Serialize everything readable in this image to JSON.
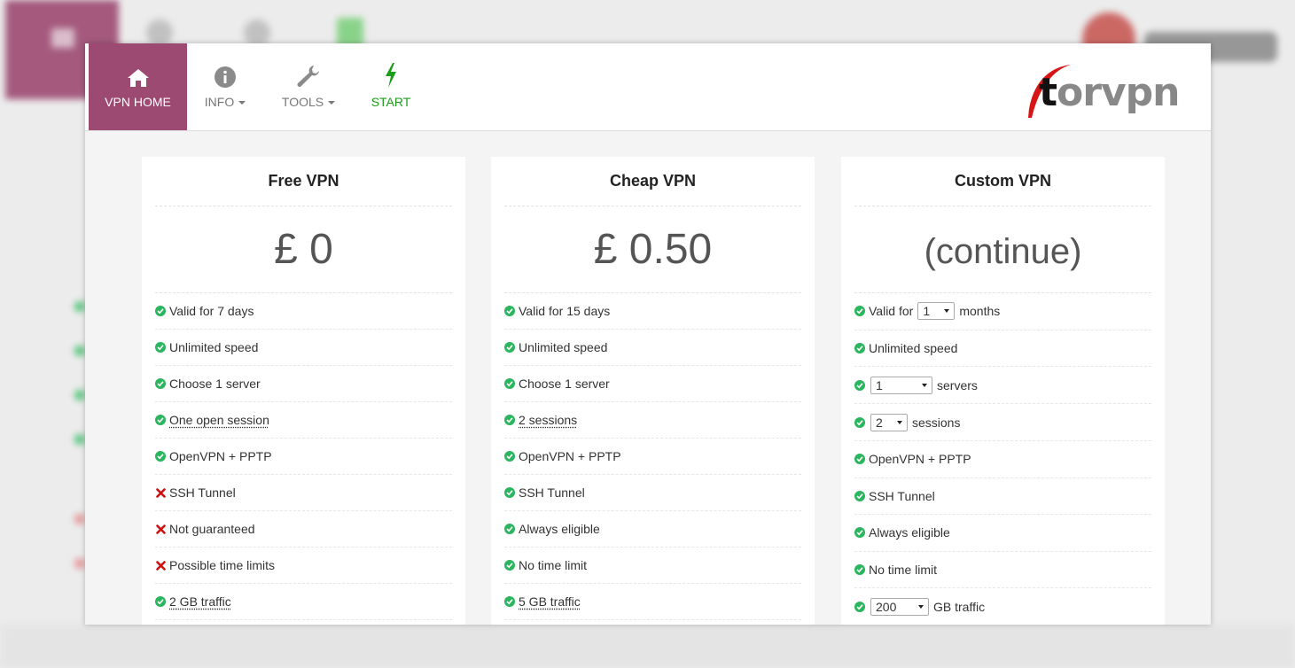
{
  "nav": {
    "items": [
      {
        "label": "VPN HOME",
        "icon": "home-icon"
      },
      {
        "label": "INFO",
        "icon": "info-icon"
      },
      {
        "label": "TOOLS",
        "icon": "wrench-icon"
      },
      {
        "label": "START",
        "icon": "lightning-icon"
      }
    ],
    "logo": {
      "first": "t",
      "rest": "orvpn"
    }
  },
  "colors": {
    "accent": "#9d4a72",
    "start": "#1a9e1a",
    "check": "#2ab55e",
    "cross": "#cc1111"
  },
  "plans": {
    "free": {
      "title": "Free VPN",
      "price": "£ 0",
      "features": [
        {
          "text": "Valid for 7 days",
          "ok": true
        },
        {
          "text": "Unlimited speed",
          "ok": true
        },
        {
          "text": "Choose 1 server",
          "ok": true
        },
        {
          "text": "One open session",
          "ok": true,
          "tip": true
        },
        {
          "text": "OpenVPN + PPTP",
          "ok": true
        },
        {
          "text": "SSH Tunnel",
          "ok": false
        },
        {
          "text": "Not guaranteed",
          "ok": false
        },
        {
          "text": "Possible time limits",
          "ok": false
        },
        {
          "text": "2 GB traffic",
          "ok": true,
          "tip": true
        }
      ]
    },
    "cheap": {
      "title": "Cheap VPN",
      "price": "£ 0.50",
      "features": [
        {
          "text": "Valid for 15 days",
          "ok": true
        },
        {
          "text": "Unlimited speed",
          "ok": true
        },
        {
          "text": "Choose 1 server",
          "ok": true
        },
        {
          "text": "2 sessions",
          "ok": true,
          "tip": true
        },
        {
          "text": "OpenVPN + PPTP",
          "ok": true
        },
        {
          "text": "SSH Tunnel",
          "ok": true
        },
        {
          "text": "Always eligible",
          "ok": true
        },
        {
          "text": "No time limit",
          "ok": true
        },
        {
          "text": "5 GB traffic",
          "ok": true,
          "tip": true
        }
      ]
    },
    "custom": {
      "title": "Custom VPN",
      "price": "(continue)",
      "valid_prefix": "Valid for",
      "months_value": "1",
      "months_suffix": "months",
      "unlimited_speed": "Unlimited speed",
      "servers_value": "1",
      "servers_suffix": "servers",
      "sessions_value": "2",
      "sessions_suffix": "sessions",
      "protocols": "OpenVPN + PPTP",
      "ssh": "SSH Tunnel",
      "eligible": "Always eligible",
      "time_limit": "No time limit",
      "traffic_value": "200",
      "traffic_suffix": "GB traffic"
    }
  }
}
